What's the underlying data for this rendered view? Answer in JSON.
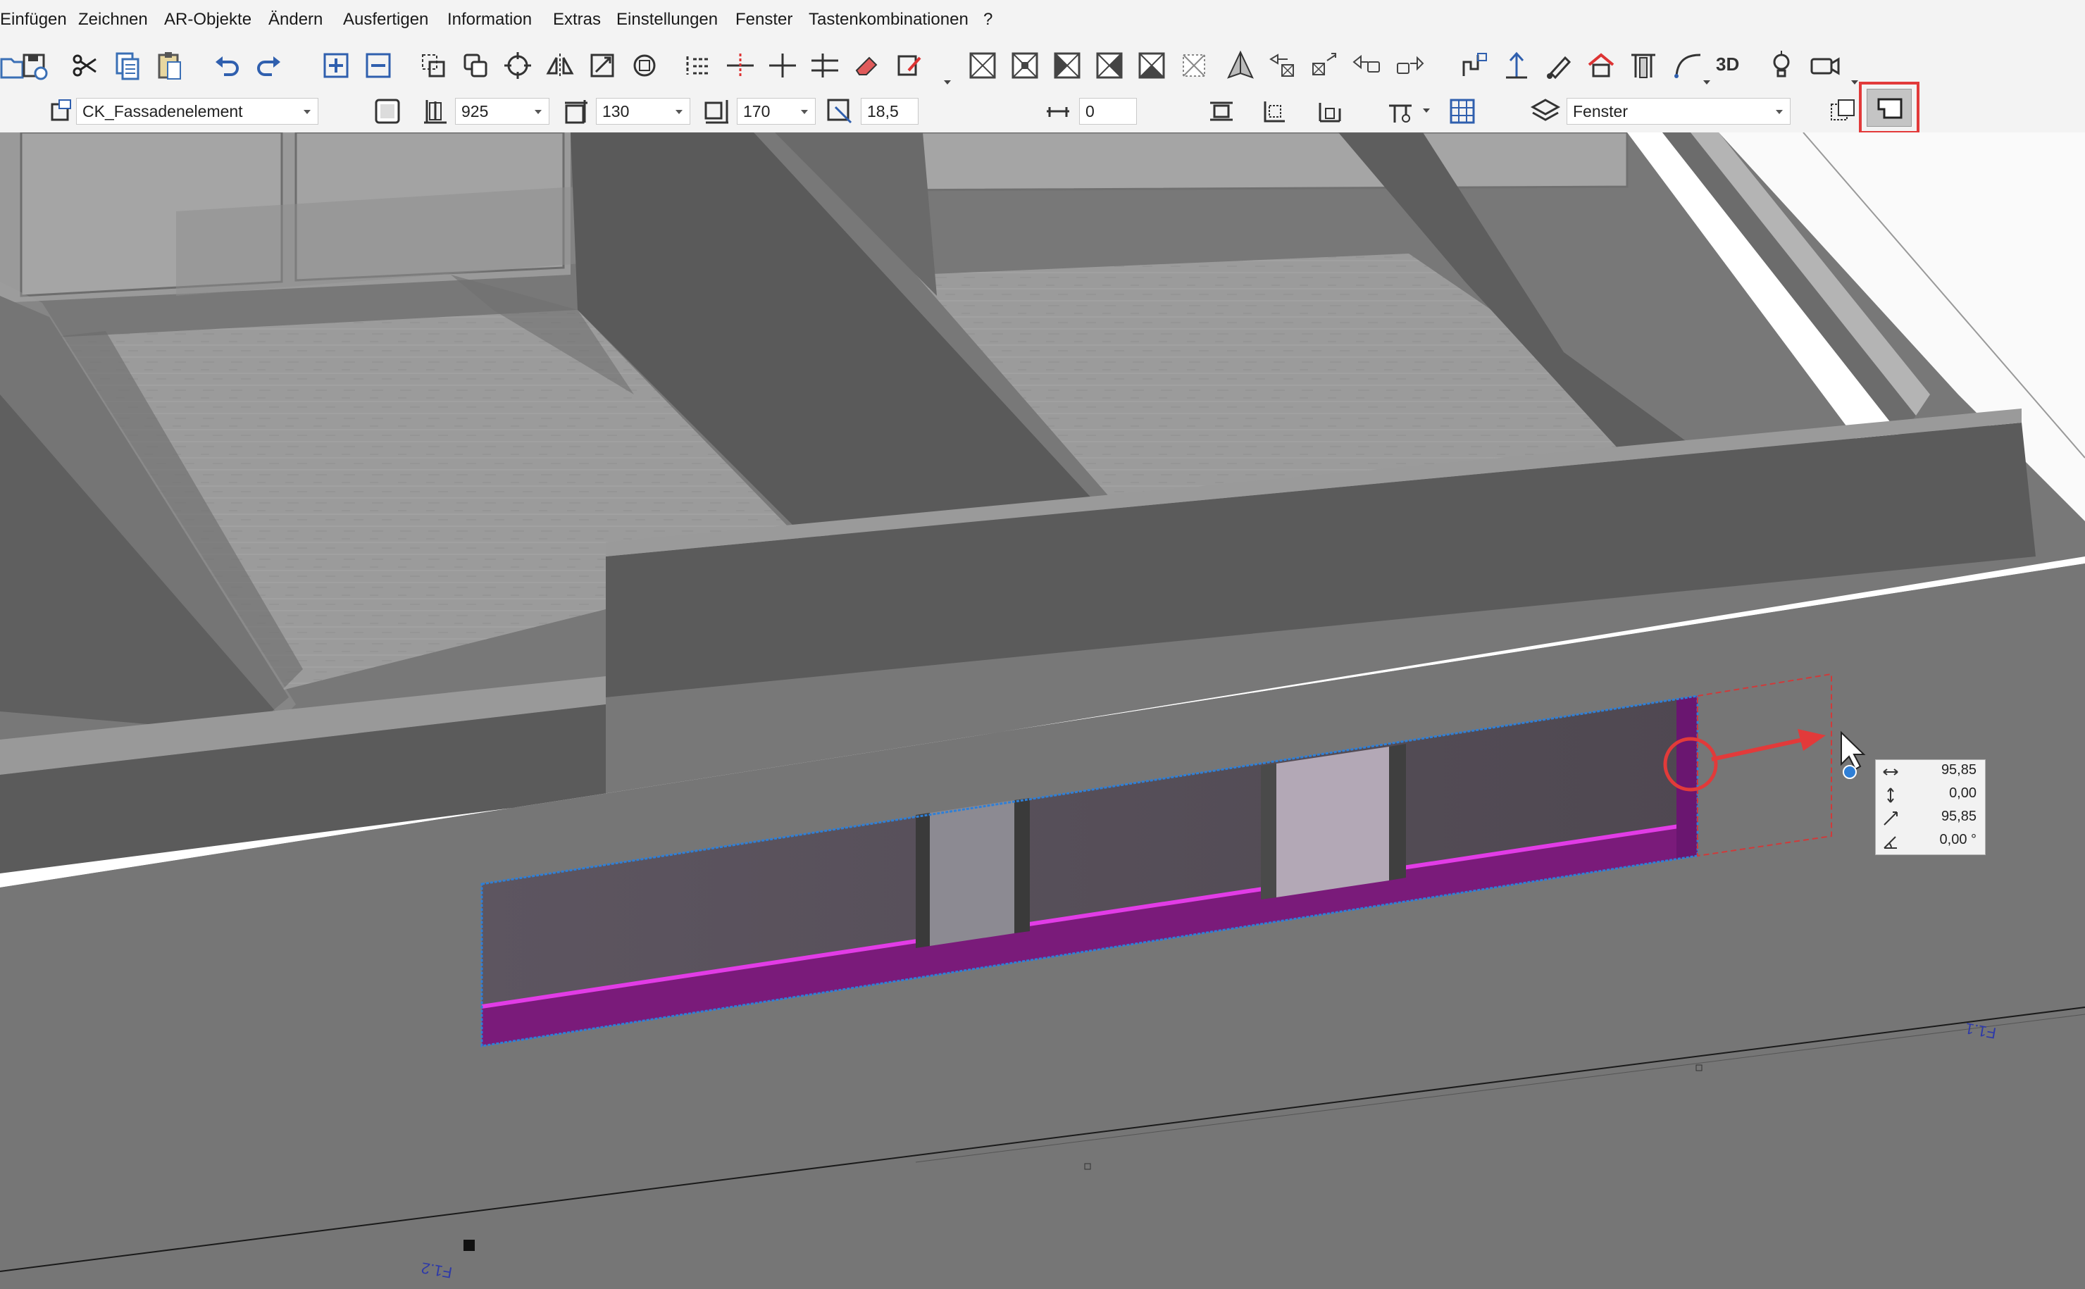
{
  "menu": [
    "Einfügen",
    "Zeichnen",
    "AR-Objekte",
    "Ändern",
    "Ausfertigen",
    "Information",
    "Extras",
    "Einstellungen",
    "Fenster",
    "Tastenkombinationen",
    "?"
  ],
  "toolbar2": {
    "object_name": "CK_Fassadenelement",
    "height_value": "925",
    "width_value": "130",
    "depth_value": "170",
    "offset_value": "18,5",
    "sill_value": "0",
    "layer_value": "Fenster"
  },
  "toolbar1": {
    "threed_label": "3D"
  },
  "readout": {
    "dx": "95,85",
    "dy": "0,00",
    "distance": "95,85",
    "angle": "0,00 °"
  },
  "viewport": {
    "wall_label_right": "F1.1",
    "wall_label_left": "F1.2"
  },
  "colors": {
    "accent_highlight": "#e23a3a",
    "selection": "#2f7fd6",
    "facade_element": "#8a1f8a"
  }
}
